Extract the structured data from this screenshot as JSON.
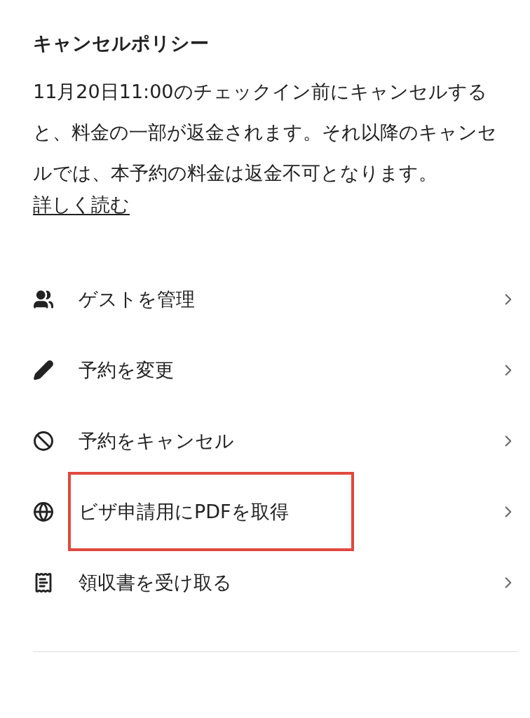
{
  "policy": {
    "title": "キャンセルポリシー",
    "body": "11月20日11:00のチェックイン前にキャンセルすると、料金の一部が返金されます。それ以降のキャンセルでは、本予約の料金は返金不可となります。",
    "link": "詳しく読む"
  },
  "menu": [
    {
      "label": "ゲストを管理",
      "highlighted": false
    },
    {
      "label": "予約を変更",
      "highlighted": false
    },
    {
      "label": "予約をキャンセル",
      "highlighted": false
    },
    {
      "label": "ビザ申請用にPDFを取得",
      "highlighted": true
    },
    {
      "label": "領収書を受け取る",
      "highlighted": false
    }
  ]
}
